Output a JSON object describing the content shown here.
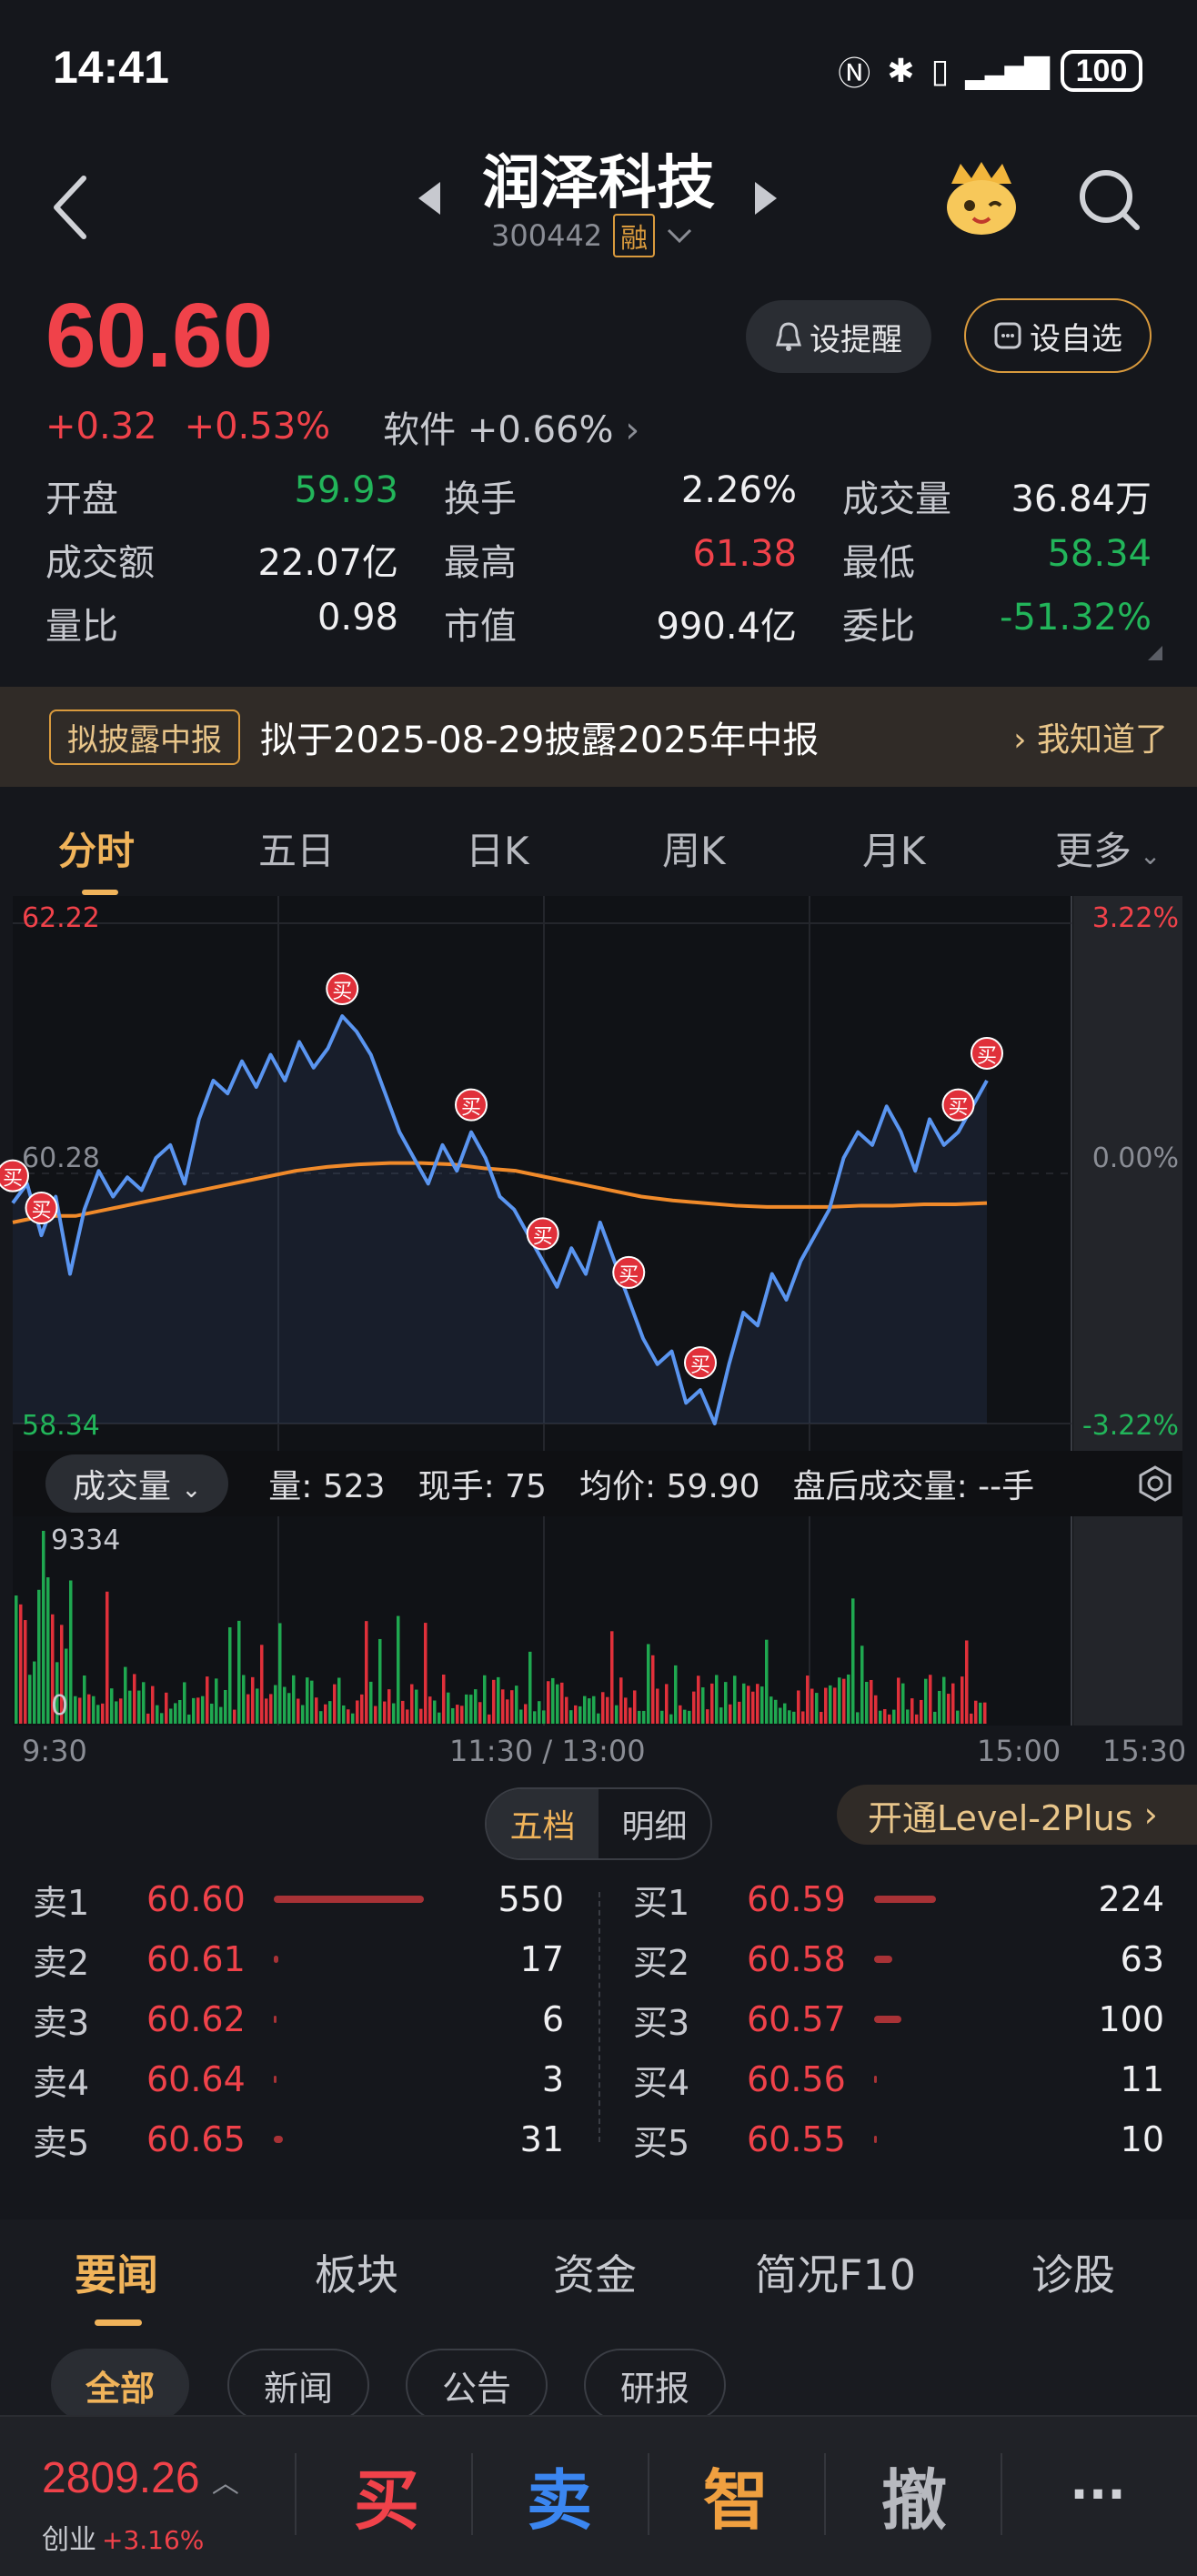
{
  "status_bar": {
    "time": "14:41",
    "battery": "100"
  },
  "header": {
    "stock_name": "润泽科技",
    "stock_code": "300442",
    "margin_badge": "融"
  },
  "quote": {
    "price": "60.60",
    "change": "+0.32",
    "change_pct": "+0.53%",
    "sector_label": "软件 +0.66%",
    "alert_label": "设提醒",
    "watch_label": "设自选",
    "stats": [
      [
        {
          "label": "开盘",
          "value": "59.93",
          "color": "green"
        },
        {
          "label": "换手",
          "value": "2.26%",
          "color": "white"
        },
        {
          "label": "成交量",
          "value": "36.84万",
          "color": "white"
        }
      ],
      [
        {
          "label": "成交额",
          "value": "22.07亿",
          "color": "white"
        },
        {
          "label": "最高",
          "value": "61.38",
          "color": "red"
        },
        {
          "label": "最低",
          "value": "58.34",
          "color": "green"
        }
      ],
      [
        {
          "label": "量比",
          "value": "0.98",
          "color": "white"
        },
        {
          "label": "市值",
          "value": "990.4亿",
          "color": "white"
        },
        {
          "label": "委比",
          "value": "-51.32%",
          "color": "green"
        }
      ]
    ]
  },
  "notice": {
    "tag": "拟披露中报",
    "text": "拟于2025-08-29披露2025年中报",
    "ack": "我知道了"
  },
  "chart_tabs": [
    "分时",
    "五日",
    "日K",
    "周K",
    "月K",
    "更多"
  ],
  "chart_data": {
    "type": "line",
    "price_axis": {
      "high": "62.22",
      "mid": "60.28",
      "low": "58.34"
    },
    "pct_axis": {
      "high": "3.22%",
      "mid": "0.00%",
      "low": "-3.22%"
    },
    "ylim": [
      58.34,
      62.22
    ],
    "x_ticks": [
      "9:30",
      "11:30 / 13:00",
      "15:00",
      "15:30"
    ],
    "series": [
      {
        "values": [
          60.05,
          60.2,
          59.8,
          60.1,
          59.5,
          60.0,
          60.3,
          60.1,
          60.25,
          60.15,
          60.4,
          60.5,
          60.2,
          60.7,
          61.0,
          60.9,
          61.15,
          60.95,
          61.2,
          61.0,
          61.3,
          61.1,
          61.25,
          61.5,
          61.38,
          61.2,
          60.9,
          60.6,
          60.4,
          60.2,
          60.5,
          60.3,
          60.6,
          60.4,
          60.1,
          60.0,
          59.8,
          59.6,
          59.4,
          59.7,
          59.5,
          59.9,
          59.6,
          59.3,
          59.0,
          58.8,
          58.9,
          58.5,
          58.6,
          58.34,
          58.8,
          59.2,
          59.1,
          59.5,
          59.3,
          59.6,
          59.8,
          60.0,
          60.4,
          60.6,
          60.5,
          60.8,
          60.6,
          60.3,
          60.7,
          60.5,
          60.6,
          60.8,
          61.0
        ]
      },
      {
        "values": [
          59.9,
          59.95,
          59.95,
          60.0,
          60.05,
          60.1,
          60.15,
          60.2,
          60.25,
          60.3,
          60.33,
          60.35,
          60.36,
          60.36,
          60.35,
          60.32,
          60.3,
          60.25,
          60.2,
          60.15,
          60.1,
          60.07,
          60.05,
          60.03,
          60.02,
          60.02,
          60.02,
          60.03,
          60.03,
          60.04,
          60.04,
          60.05
        ]
      }
    ],
    "markers": [
      "买",
      "买",
      "买",
      "买",
      "买",
      "买",
      "买",
      "买",
      "买"
    ],
    "volume": {
      "max_label": "9334",
      "min_label": "0"
    }
  },
  "volume_header": {
    "selector": "成交量",
    "vol": "量: 523",
    "hand": "现手: 75",
    "avg": "均价: 59.90",
    "after": "盘后成交量: --手"
  },
  "order_book": {
    "tabs": [
      "五档",
      "明细"
    ],
    "level2": "开通Level-2Plus",
    "sell": [
      {
        "label": "卖1",
        "price": "60.60",
        "vol": "550",
        "bar": 1.0
      },
      {
        "label": "卖2",
        "price": "60.61",
        "vol": "17",
        "bar": 0.03
      },
      {
        "label": "卖3",
        "price": "60.62",
        "vol": "6",
        "bar": 0.01
      },
      {
        "label": "卖4",
        "price": "60.64",
        "vol": "3",
        "bar": 0.005
      },
      {
        "label": "卖5",
        "price": "60.65",
        "vol": "31",
        "bar": 0.06
      }
    ],
    "buy": [
      {
        "label": "买1",
        "price": "60.59",
        "vol": "224",
        "bar": 0.41
      },
      {
        "label": "买2",
        "price": "60.58",
        "vol": "63",
        "bar": 0.12
      },
      {
        "label": "买3",
        "price": "60.57",
        "vol": "100",
        "bar": 0.18
      },
      {
        "label": "买4",
        "price": "60.56",
        "vol": "11",
        "bar": 0.02
      },
      {
        "label": "买5",
        "price": "60.55",
        "vol": "10",
        "bar": 0.02
      }
    ]
  },
  "news": {
    "tabs": [
      "要闻",
      "板块",
      "资金",
      "简况F10",
      "诊股"
    ],
    "chips": [
      "全部",
      "新闻",
      "公告",
      "研报"
    ]
  },
  "bottom_bar": {
    "index_value": "2809.26",
    "index_name": "创业",
    "index_change": "+3.16%",
    "buy": "买",
    "sell": "卖",
    "smart": "智",
    "cancel": "撤",
    "more": "···"
  },
  "colors": {
    "up": "#f0424a",
    "down": "#22b55a",
    "accent": "#f0b35a",
    "price_line": "#5a95f0",
    "avg_line": "#f08a2a"
  }
}
